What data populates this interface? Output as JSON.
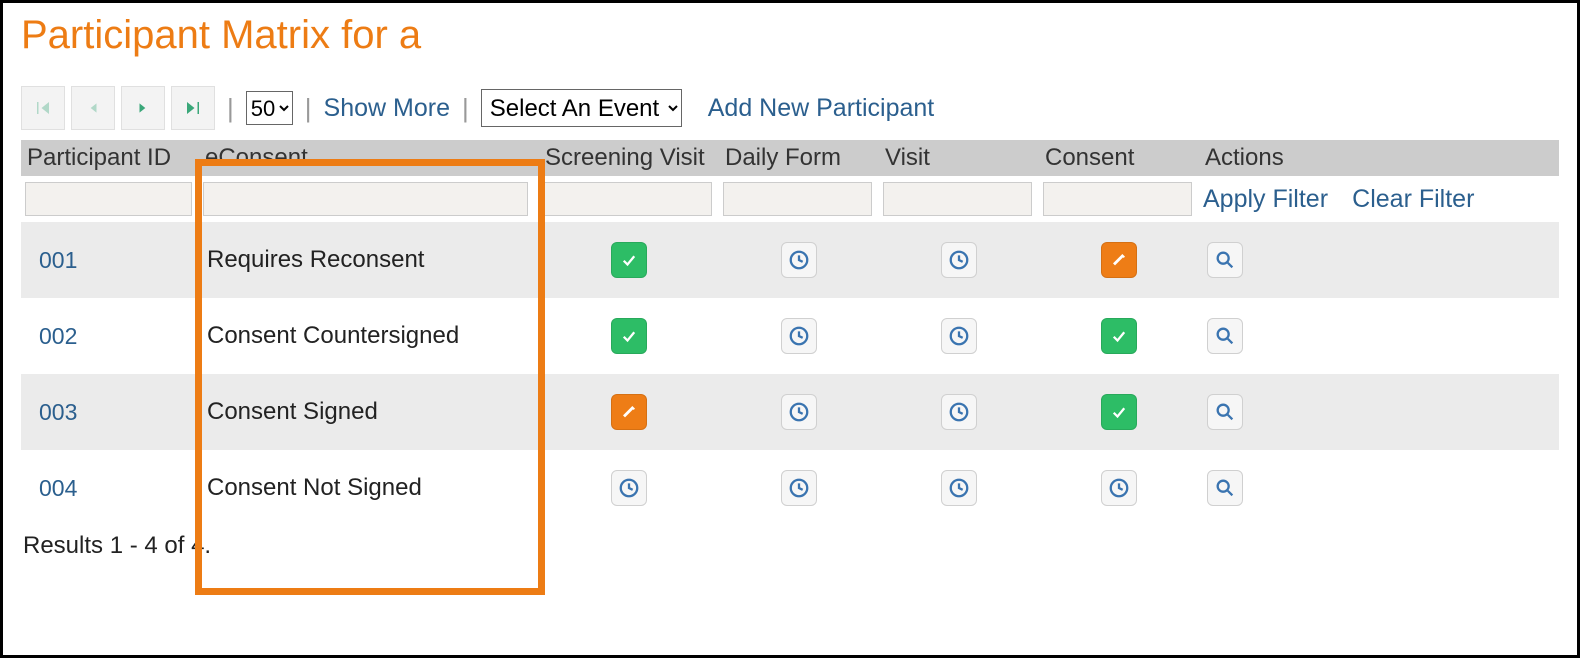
{
  "title": "Participant Matrix for a",
  "toolbar": {
    "page_size_value": "50",
    "page_size_options": [
      "50"
    ],
    "show_more": "Show More",
    "event_select_value": "Select An Event",
    "event_select_options": [
      "Select An Event"
    ],
    "add_participant": "Add New Participant"
  },
  "columns": {
    "participant_id": "Participant ID",
    "econsent": "eConsent",
    "screening_visit": "Screening Visit",
    "daily_form": "Daily Form",
    "visit": "Visit",
    "consent": "Consent",
    "actions": "Actions"
  },
  "filters": {
    "apply": "Apply Filter",
    "clear": "Clear Filter"
  },
  "rows": [
    {
      "pid": "001",
      "econsent": "Requires Reconsent",
      "screening": "check",
      "daily": "clock",
      "visit": "clock",
      "consent": "pencil",
      "action": "search"
    },
    {
      "pid": "002",
      "econsent": "Consent Countersigned",
      "screening": "check",
      "daily": "clock",
      "visit": "clock",
      "consent": "check",
      "action": "search"
    },
    {
      "pid": "003",
      "econsent": "Consent Signed",
      "screening": "pencil",
      "daily": "clock",
      "visit": "clock",
      "consent": "check",
      "action": "search"
    },
    {
      "pid": "004",
      "econsent": "Consent Not Signed",
      "screening": "clock",
      "daily": "clock",
      "visit": "clock",
      "consent": "clock",
      "action": "search"
    }
  ],
  "results": "Results 1 - 4 of 4."
}
